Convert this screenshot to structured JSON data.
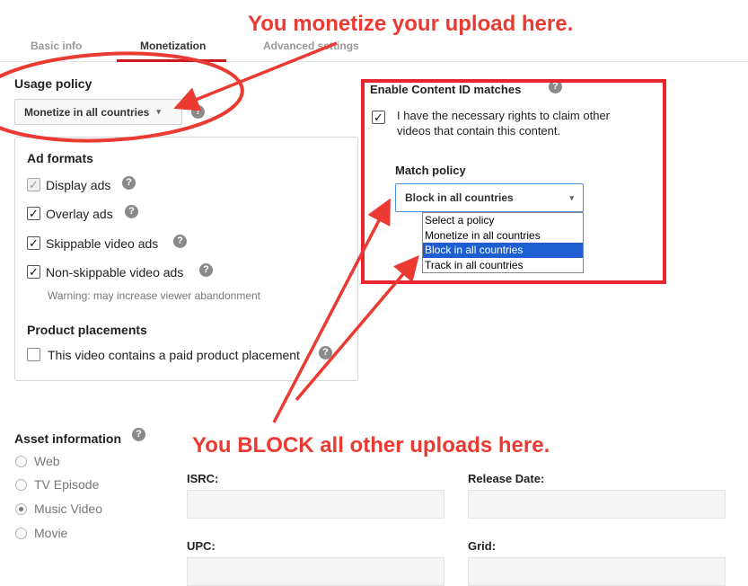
{
  "annotations": {
    "top": "You monetize your upload here.",
    "bottom": "You BLOCK all other uploads here."
  },
  "tabs": [
    {
      "label": "Basic info",
      "active": false
    },
    {
      "label": "Monetization",
      "active": true
    },
    {
      "label": "Advanced settings",
      "active": false
    }
  ],
  "usage_policy": {
    "title": "Usage policy",
    "selected": "Monetize in all countries"
  },
  "ad_formats": {
    "title": "Ad formats",
    "items": [
      {
        "label": "Display ads",
        "checked": true,
        "disabled": true
      },
      {
        "label": "Overlay ads",
        "checked": true,
        "disabled": false
      },
      {
        "label": "Skippable video ads",
        "checked": true,
        "disabled": false
      },
      {
        "label": "Non-skippable video ads",
        "checked": true,
        "disabled": false
      }
    ],
    "warning": "Warning: may increase viewer abandonment"
  },
  "product_placements": {
    "title": "Product placements",
    "checkbox_label": "This video contains a paid product placement",
    "checked": false
  },
  "content_id": {
    "title": "Enable Content ID matches",
    "rights_label_line1": "I have the necessary rights to claim other",
    "rights_label_line2": "videos that contain this content.",
    "rights_checked": true,
    "match_policy_title": "Match policy",
    "match_policy_selected": "Block in all countries",
    "options": [
      "Select a policy",
      "Monetize in all countries",
      "Block in all countries",
      "Track in all countries"
    ],
    "highlighted_option": "Block in all countries"
  },
  "asset_information": {
    "title": "Asset information",
    "types": [
      {
        "label": "Web",
        "checked": false
      },
      {
        "label": "TV Episode",
        "checked": false
      },
      {
        "label": "Music Video",
        "checked": true
      },
      {
        "label": "Movie",
        "checked": false
      }
    ],
    "fields": {
      "isrc": "ISRC:",
      "release_date": "Release Date:",
      "upc": "UPC:",
      "grid": "Grid:"
    }
  },
  "colors": {
    "annotation_red": "#ea3a32",
    "tab_active_underline": "#cc181e",
    "dropdown_highlight": "#1d5fd0"
  },
  "help_symbol": "?",
  "checkmark": "✓"
}
